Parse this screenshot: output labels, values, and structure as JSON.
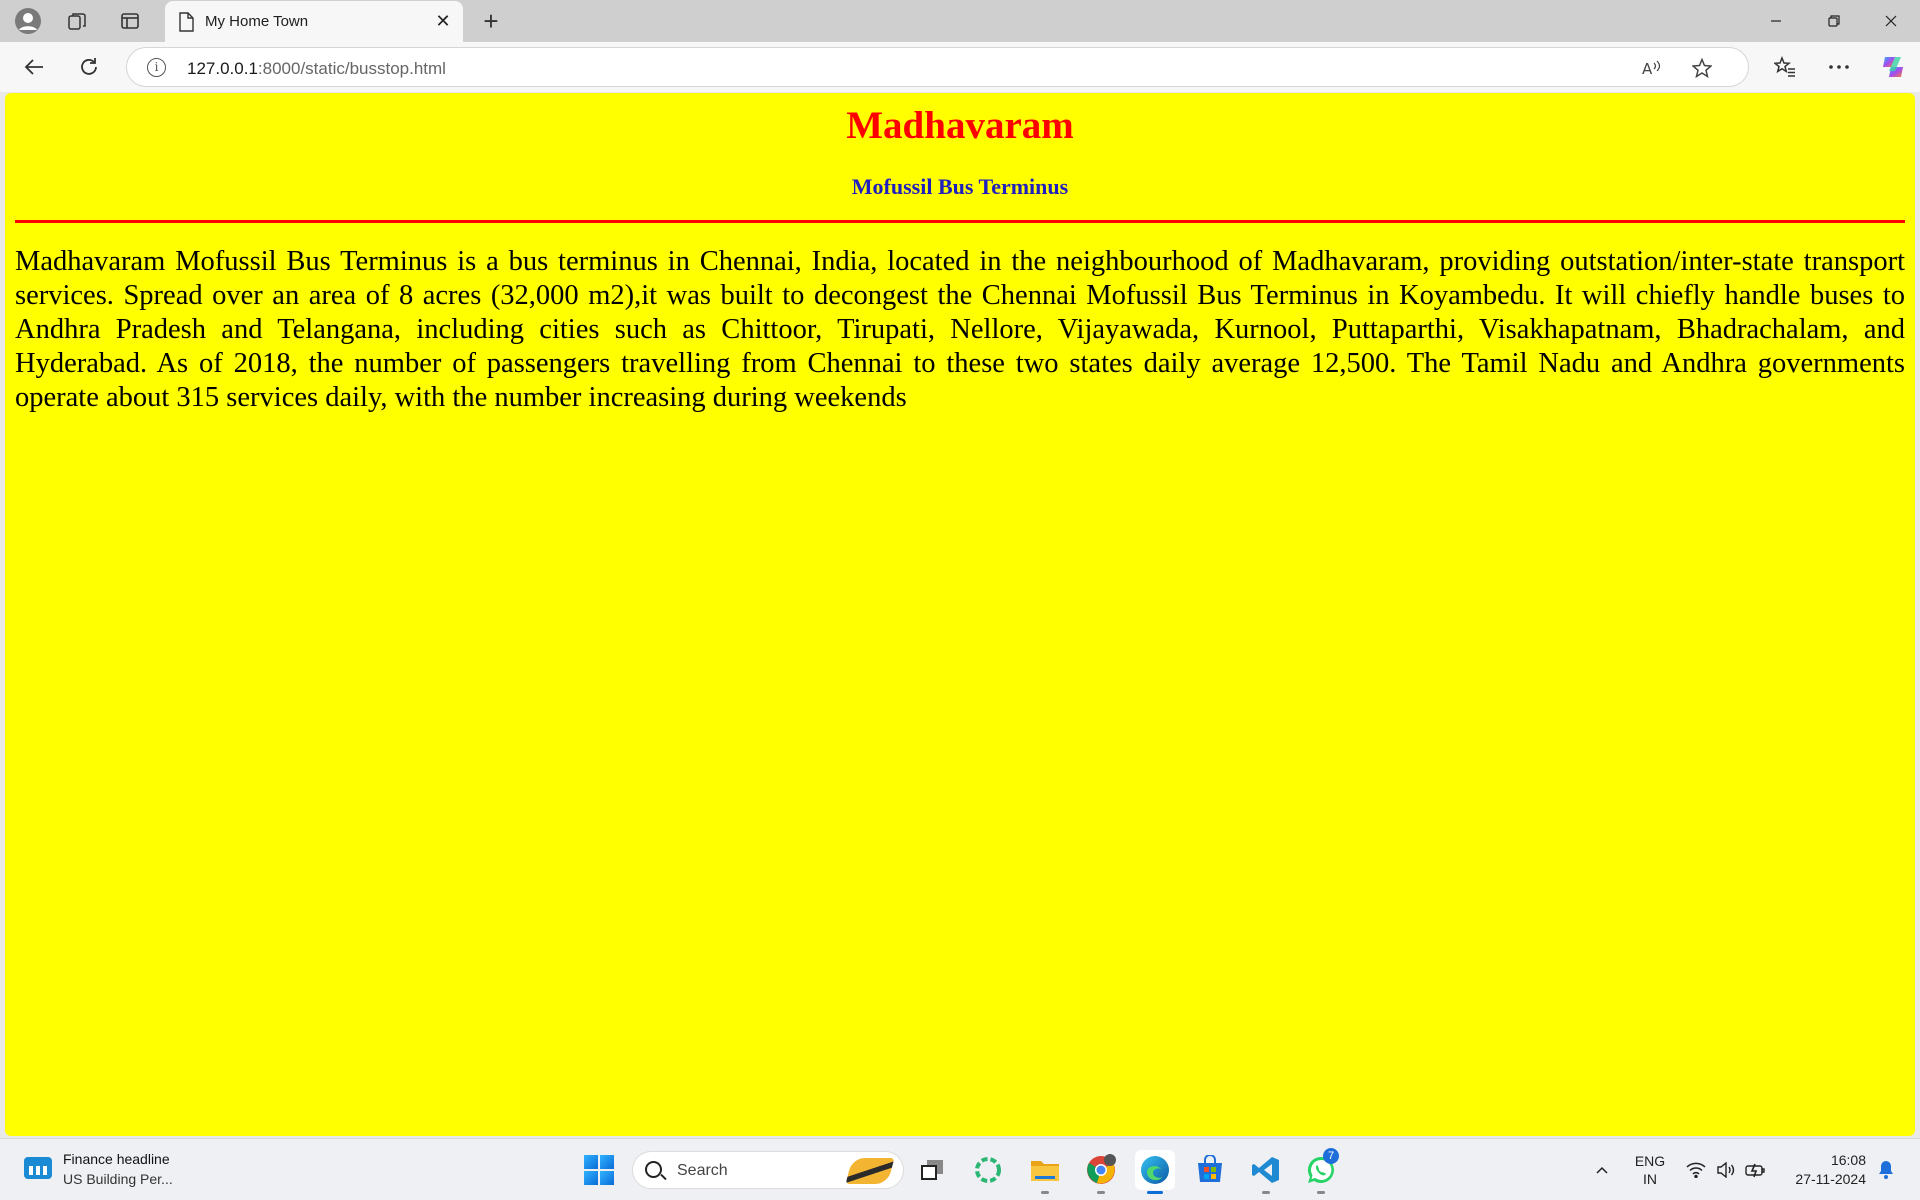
{
  "browser": {
    "tab_title": "My Home Town",
    "url_host": "127.0.0.1",
    "url_path": ":8000/static/busstop.html",
    "new_tab_symbol": "+",
    "close_symbol": "✕"
  },
  "page": {
    "background_color": "#ffff00",
    "heading": "Madhavaram",
    "heading_color": "#ff0000",
    "subheading": "Mofussil Bus Terminus",
    "subheading_color": "#1f1fbf",
    "rule_color": "#ff0000",
    "paragraph": "Madhavaram Mofussil Bus Terminus is a bus terminus in Chennai, India, located in the neighbourhood of Madhavaram, providing outstation/inter-state transport services. Spread over an area of 8 acres (32,000 m2),it was built to decongest the Chennai Mofussil Bus Terminus in Koyambedu. It will chiefly handle buses to Andhra Pradesh and Telangana, including cities such as Chittoor, Tirupati, Nellore, Vijayawada, Kurnool, Puttaparthi, Visakhapatnam, Bhadrachalam, and Hyderabad. As of 2018, the number of passengers travelling from Chennai to these two states daily average 12,500. The Tamil Nadu and Andhra governments operate about 315 services daily, with the number increasing during weekends"
  },
  "taskbar": {
    "widget_title": "Finance headline",
    "widget_subtitle": "US Building Per...",
    "search_placeholder": "Search",
    "whatsapp_badge": "7",
    "language_line1": "ENG",
    "language_line2": "IN",
    "time": "16:08",
    "date": "27-11-2024",
    "pinned_apps": [
      "task-view",
      "copilot-app",
      "file-explorer",
      "chrome",
      "edge",
      "microsoft-store",
      "vscode",
      "whatsapp"
    ]
  }
}
